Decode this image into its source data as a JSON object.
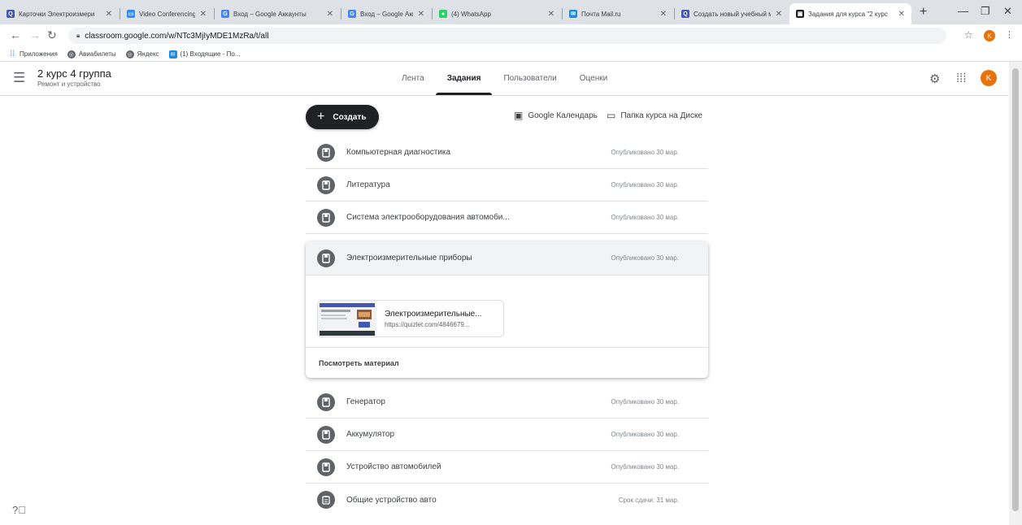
{
  "browser": {
    "tabs": [
      {
        "title": "Карточки Электроизмери",
        "favicon_color": "#4257b2",
        "favicon": "Q",
        "active": false
      },
      {
        "title": "Video Conferencing, Web C",
        "favicon_color": "#2d8cff",
        "favicon": "▭",
        "active": false
      },
      {
        "title": "Вход – Google Аккаунты",
        "favicon_color": "#4285f4",
        "favicon": "G",
        "active": false
      },
      {
        "title": "Вход – Google Аккаунты",
        "favicon_color": "#4285f4",
        "favicon": "G",
        "active": false
      },
      {
        "title": "(4) WhatsApp",
        "favicon_color": "#25d366",
        "favicon": "●",
        "active": false
      },
      {
        "title": "Почта Mail.ru",
        "favicon_color": "#168de2",
        "favicon": "✉",
        "active": false
      },
      {
        "title": "Создать новый учебный м",
        "favicon_color": "#4257b2",
        "favicon": "Q",
        "active": false
      },
      {
        "title": "Задания для курса \"2 курс",
        "favicon_color": "#202124",
        "favicon": "▣",
        "active": true
      }
    ],
    "url": "classroom.google.com/w/NTc3MjIyMDE1MzRa/t/all",
    "profile_initial": "K",
    "bookmarks": [
      {
        "label": "Приложения",
        "icon": "apps-icon",
        "color": "#4285f4"
      },
      {
        "label": "Авиабилеты",
        "icon": "globe-icon",
        "color": "#5f6368"
      },
      {
        "label": "Яндекс",
        "icon": "globe-icon",
        "color": "#5f6368"
      },
      {
        "label": "(1) Входящие - По...",
        "icon": "mail-icon",
        "color": "#168de2"
      }
    ]
  },
  "header": {
    "course_title": "2 курс 4 группа",
    "course_subtitle": "Ремонт и устройство",
    "tabs": [
      "Лента",
      "Задания",
      "Пользователи",
      "Оценки"
    ],
    "active_tab": "Задания",
    "avatar_initial": "K",
    "avatar_color": "#e8710a"
  },
  "toolbar": {
    "create_label": "Создать",
    "calendar_label": "Google Календарь",
    "drive_label": "Папка курса на Диске"
  },
  "items_top": [
    {
      "title": "Компьютерная диагностика",
      "meta": "Опубликовано 30 мар.",
      "icon": "material-icon"
    },
    {
      "title": "Литература",
      "meta": "Опубликовано 30 мар.",
      "icon": "material-icon"
    },
    {
      "title": "Система электрооборудования автомоби...",
      "meta": "Опубликовано 30 мар.",
      "icon": "material-icon"
    }
  ],
  "expanded_item": {
    "title": "Электроизмерительные приборы",
    "meta": "Опубликовано 30 мар.",
    "attachment_title": "Электроизмерительные...",
    "attachment_url": "https://quizlet.com/4846679...",
    "view_label": "Посмотреть материал"
  },
  "items_bottom": [
    {
      "title": "Генератор",
      "meta": "Опубликовано 30 мар.",
      "icon": "material-icon"
    },
    {
      "title": "Аккумулятор",
      "meta": "Опубликовано 30 мар.",
      "icon": "material-icon"
    },
    {
      "title": "Устройство автомобилей",
      "meta": "Опубликовано 30 мар.",
      "icon": "material-icon"
    },
    {
      "title": "Общие устройство авто",
      "meta": "Срок сдачи: 31 мар.",
      "icon": "assignment-icon"
    }
  ]
}
